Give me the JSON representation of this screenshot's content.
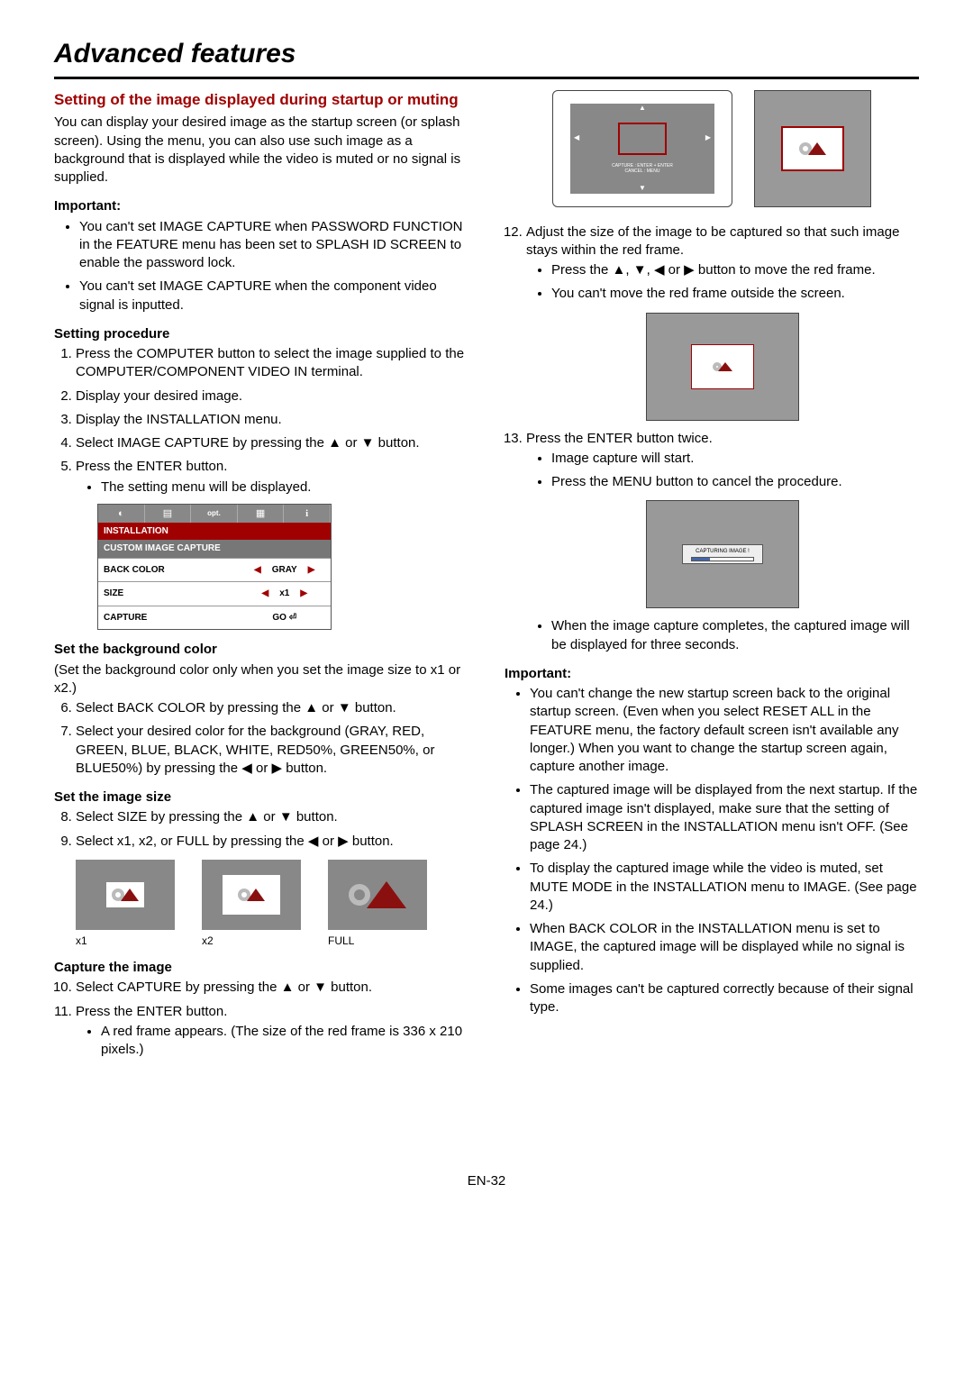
{
  "page_title": "Advanced features",
  "page_number": "EN-32",
  "left": {
    "heading": "Setting of the image displayed during startup or muting",
    "intro": "You can display your desired image as the startup screen (or splash screen). Using the menu, you can also use such image as a background that is displayed while the video is muted or no signal is supplied.",
    "important_label": "Important:",
    "important_items": [
      "You can't set IMAGE CAPTURE when PASSWORD FUNCTION in the FEATURE menu has been set to SPLASH ID SCREEN to enable the password lock.",
      "You can't set IMAGE CAPTURE when the component video signal is inputted."
    ],
    "setting_proc_label": "Setting procedure",
    "steps": {
      "s1": "Press the COMPUTER button to select the image supplied to the COMPUTER/COMPONENT VIDEO IN terminal.",
      "s2": "Display your desired image.",
      "s3": "Display the INSTALLATION menu.",
      "s4a": "Select IMAGE CAPTURE by pressing the ",
      "s4b": " or ",
      "s4c": " button.",
      "s5": "Press the ENTER button.",
      "s5_sub": "The setting menu will be displayed."
    },
    "menu": {
      "title": "INSTALLATION",
      "subtitle": "CUSTOM IMAGE CAPTURE",
      "rows": [
        {
          "label": "BACK COLOR",
          "value": "GRAY",
          "arrows": true
        },
        {
          "label": "SIZE",
          "value": "x1",
          "arrows": true
        },
        {
          "label": "CAPTURE",
          "value": "GO ⏎",
          "arrows": false
        }
      ],
      "tab_opt": "opt.",
      "tab_i": "i"
    },
    "bg_heading": "Set the background color",
    "bg_note": "(Set the background color only when you set the image size to x1 or x2.)",
    "s6a": "Select BACK COLOR by pressing the ",
    "s6b": " or ",
    "s6c": " button.",
    "s7a": "Select your desired color for the background (GRAY, RED, GREEN, BLUE, BLACK, WHITE, RED50%, GREEN50%, or BLUE50%) by pressing the ",
    "s7b": " or ",
    "s7c": " button.",
    "size_heading": "Set the image size",
    "s8a": "Select SIZE by pressing the ",
    "s8b": " or ",
    "s8c": " button.",
    "s9a": "Select x1, x2, or FULL by pressing the ",
    "s9b": " or ",
    "s9c": " button.",
    "size_labels": {
      "x1": "x1",
      "x2": "x2",
      "full": "FULL"
    },
    "capture_heading": "Capture the image",
    "s10a": "Select CAPTURE by pressing the ",
    "s10b": " or ",
    "s10c": " button.",
    "s11": "Press the ENTER button.",
    "s11_sub": "A red frame appears. (The size of the red frame is 336 x 210 pixels.)"
  },
  "right": {
    "frame_label1": "CAPTURE : ENTER + ENTER",
    "frame_label2": "CANCEL : MENU",
    "s12": "Adjust the size of the image to be captured so that such image stays within the red frame.",
    "s12_sub1a": "Press the ",
    "s12_sub1b": " or ",
    "s12_sub1c": " button to move the red frame.",
    "s12_sub2": "You can't move the red frame outside the screen.",
    "s13": "Press the ENTER button twice.",
    "s13_sub1": "Image capture will start.",
    "s13_sub2": "Press the MENU button to cancel the procedure.",
    "capturing_label": "CAPTURING IMAGE !",
    "s13_sub3": "When the image capture completes, the captured image will be displayed for three seconds.",
    "important2_label": "Important:",
    "important2_items": [
      "You can't change the new startup screen back to the original startup screen. (Even when you select RESET ALL in the FEATURE menu, the factory default screen isn't available any longer.) When you want to change the startup screen again, capture another image.",
      "The captured image will be displayed from the next startup. If the captured image isn't displayed, make sure that the setting of SPLASH SCREEN in the INSTALLATION menu isn't OFF. (See page 24.)",
      "To display the captured image while the video is muted, set MUTE MODE in the INSTALLATION menu to IMAGE. (See page 24.)",
      "When BACK COLOR in the INSTALLATION menu is set to IMAGE, the captured image will be displayed while no signal is supplied.",
      "Some images can't be captured correctly because of their signal type."
    ]
  }
}
